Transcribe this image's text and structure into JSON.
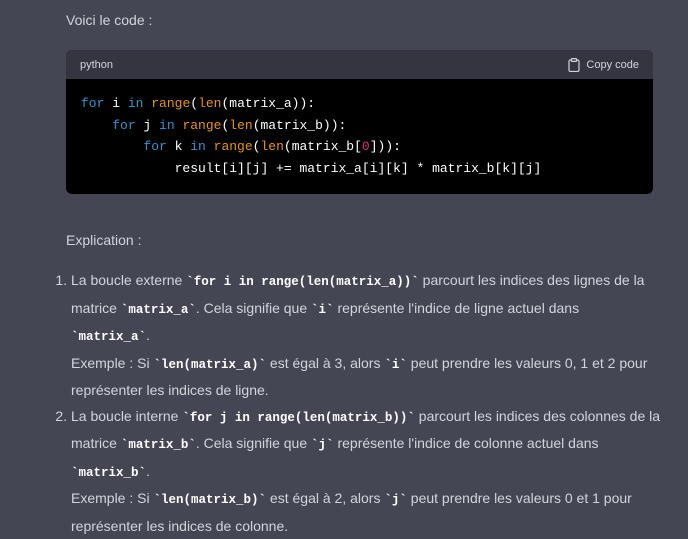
{
  "intro_text": "Voici le code :",
  "code_block": {
    "language": "python",
    "copy_label": "Copy code",
    "lines": [
      {
        "indent": "",
        "parts": [
          [
            "kw",
            "for"
          ],
          [
            "t",
            " i "
          ],
          [
            "kw",
            "in"
          ],
          [
            "t",
            " "
          ],
          [
            "fn",
            "range"
          ],
          [
            "t",
            "("
          ],
          [
            "fn",
            "len"
          ],
          [
            "t",
            "(matrix_a)):"
          ]
        ]
      },
      {
        "indent": "    ",
        "parts": [
          [
            "kw",
            "for"
          ],
          [
            "t",
            " j "
          ],
          [
            "kw",
            "in"
          ],
          [
            "t",
            " "
          ],
          [
            "fn",
            "range"
          ],
          [
            "t",
            "("
          ],
          [
            "fn",
            "len"
          ],
          [
            "t",
            "(matrix_b)):"
          ]
        ]
      },
      {
        "indent": "        ",
        "parts": [
          [
            "kw",
            "for"
          ],
          [
            "t",
            " k "
          ],
          [
            "kw",
            "in"
          ],
          [
            "t",
            " "
          ],
          [
            "fn",
            "range"
          ],
          [
            "t",
            "("
          ],
          [
            "fn",
            "len"
          ],
          [
            "t",
            "(matrix_b["
          ],
          [
            "num",
            "0"
          ],
          [
            "t",
            "])):"
          ]
        ]
      },
      {
        "indent": "            ",
        "parts": [
          [
            "t",
            "result[i][j] += matrix_a[i][k] * matrix_b[k][j]"
          ]
        ]
      }
    ]
  },
  "explication_title": "Explication :",
  "items": [
    {
      "a": "La boucle externe ",
      "c1": "for i in range(len(matrix_a))",
      "b": " parcourt les indices des lignes de la matrice ",
      "c2": "matrix_a",
      "d": ". Cela signifie que ",
      "c3": "i",
      "e": " représente l'indice de ligne actuel dans ",
      "c4": "matrix_a",
      "f": ".",
      "ex_a": "Exemple : Si ",
      "ex_c1": "len(matrix_a)",
      "ex_b": " est égal à 3, alors ",
      "ex_c2": "i",
      "ex_c": " peut prendre les valeurs 0, 1 et 2 pour représenter les indices de ligne."
    },
    {
      "a": "La boucle interne ",
      "c1": "for j in range(len(matrix_b))",
      "b": " parcourt les indices des colonnes de la matrice ",
      "c2": "matrix_b",
      "d": ". Cela signifie que ",
      "c3": "j",
      "e": " représente l'indice de colonne actuel dans ",
      "c4": "matrix_b",
      "f": ".",
      "ex_a": "Exemple : Si ",
      "ex_c1": "len(matrix_b)",
      "ex_b": " est égal à 2, alors ",
      "ex_c2": "j",
      "ex_c": " peut prendre les valeurs 0 et 1 pour représenter les indices de colonne."
    }
  ]
}
